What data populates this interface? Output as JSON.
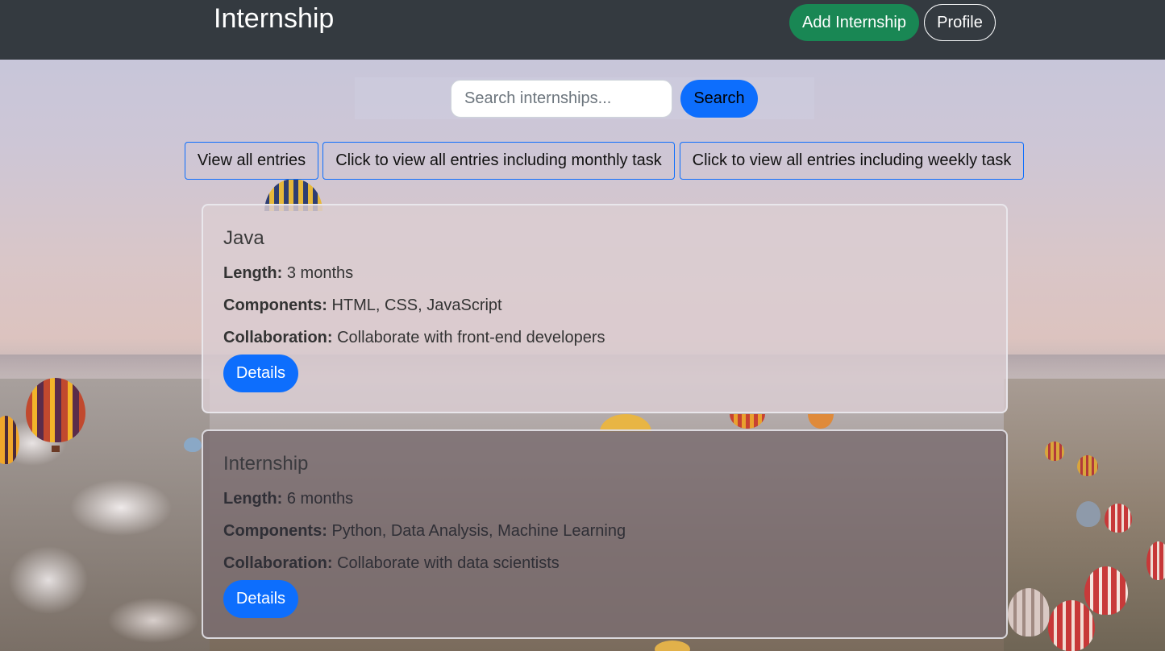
{
  "navbar": {
    "brand": "Internship",
    "add_label": "Add Internship",
    "profile_label": "Profile"
  },
  "search": {
    "placeholder": "Search internships...",
    "value": "",
    "button_label": "Search"
  },
  "filters": [
    {
      "label": "View all entries"
    },
    {
      "label": "Click to view all entries including monthly task"
    },
    {
      "label": "Click to view all entries including weekly task"
    }
  ],
  "cards": [
    {
      "title": "Java",
      "length_label": "Length:",
      "length": "3 months",
      "components_label": "Components:",
      "components": "HTML, CSS, JavaScript",
      "collaboration_label": "Collaboration:",
      "collaboration": "Collaborate with front-end developers",
      "button_label": "Details"
    },
    {
      "title": "Internship",
      "length_label": "Length:",
      "length": "6 months",
      "components_label": "Components:",
      "components": "Python, Data Analysis, Machine Learning",
      "collaboration_label": "Collaboration:",
      "collaboration": "Collaborate with data scientists",
      "button_label": "Details"
    }
  ],
  "colors": {
    "navbar_bg": "#343a40",
    "primary": "#0d6efd",
    "success": "#198754"
  }
}
